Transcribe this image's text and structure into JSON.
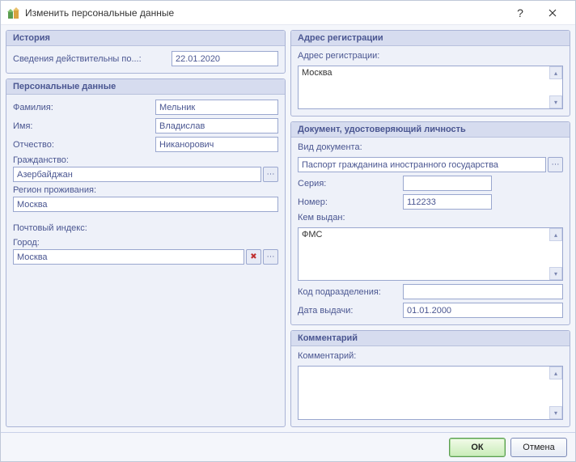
{
  "window": {
    "title": "Изменить персональные данные"
  },
  "history": {
    "legend": "История",
    "valid_label": "Сведения действительны по...:",
    "valid_value": "22.01.2020"
  },
  "personal": {
    "legend": "Персональные данные",
    "lastname_label": "Фамилия:",
    "lastname_value": "Мельник",
    "firstname_label": "Имя:",
    "firstname_value": "Владислав",
    "patronymic_label": "Отчество:",
    "patronymic_value": "Никанорович",
    "citizenship_label": "Гражданство:",
    "citizenship_value": "Азербайджан",
    "region_label": "Регион проживания:",
    "region_value": "Москва",
    "postal_label": "Почтовый индекс:",
    "postal_value": "",
    "city_label": "Город:",
    "city_value": "Москва"
  },
  "address": {
    "legend": "Адрес регистрации",
    "label": "Адрес регистрации:",
    "value": "Москва"
  },
  "document": {
    "legend": "Документ, удостоверяющий личность",
    "type_label": "Вид документа:",
    "type_value": "Паспорт гражданина иностранного государства",
    "series_label": "Серия:",
    "series_value": "",
    "number_label": "Номер:",
    "number_value": "112233",
    "issued_by_label": "Кем выдан:",
    "issued_by_value": "ФМС",
    "dept_code_label": "Код подразделения:",
    "dept_code_value": "",
    "issue_date_label": "Дата выдачи:",
    "issue_date_value": "01.01.2000"
  },
  "comment": {
    "legend": "Комментарий",
    "label": "Комментарий:",
    "value": ""
  },
  "buttons": {
    "ok": "ОК",
    "cancel": "Отмена"
  },
  "icons": {
    "ellipsis": "⋯",
    "clear": "✖"
  }
}
